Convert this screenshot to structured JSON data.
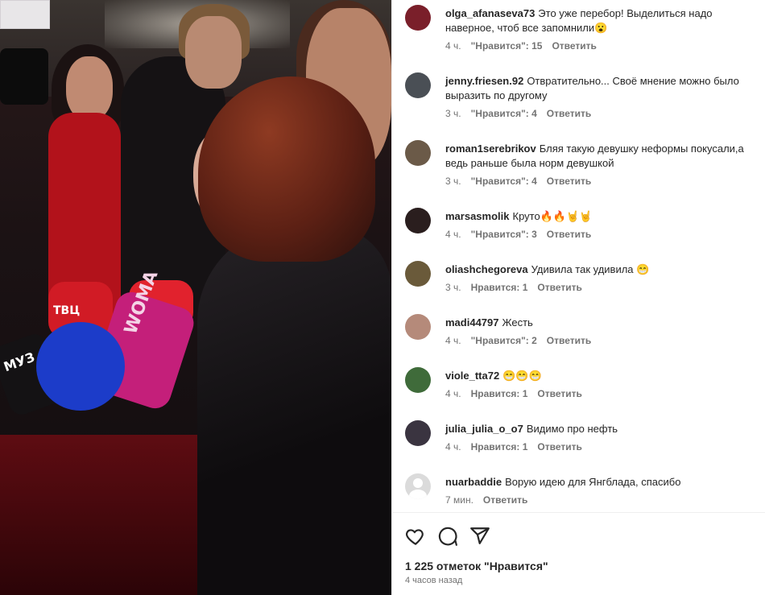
{
  "photo": {
    "mic_labels": {
      "tvc": "ТВЦ",
      "woman": "WOMA",
      "muz": "МУЗ"
    }
  },
  "comments": [
    {
      "username": "olga_afanaseva73",
      "text": "Это уже перебор! Выделиться надо наверное, чтоб все запомнили😮",
      "time": "4 ч.",
      "likes": "\"Нравится\": 15",
      "reply": "Ответить",
      "avatar_color": "#7a1f2a"
    },
    {
      "username": "jenny.friesen.92",
      "text": "Отвратительно... Своё мнение можно было выразить по другому",
      "time": "3 ч.",
      "likes": "\"Нравится\": 4",
      "reply": "Ответить",
      "avatar_color": "#4a4f55"
    },
    {
      "username": "roman1serebrikov",
      "text": "Бляя такую девушку неформы покусали,а ведь раньше была норм девушкой",
      "time": "3 ч.",
      "likes": "\"Нравится\": 4",
      "reply": "Ответить",
      "avatar_color": "#6b5a48"
    },
    {
      "username": "marsasmolik",
      "text": "Круто🔥🔥🤘🤘",
      "time": "4 ч.",
      "likes": "\"Нравится\": 3",
      "reply": "Ответить",
      "avatar_color": "#2a1e1e"
    },
    {
      "username": "oliashchegoreva",
      "text": "Удивила так удивила 😁",
      "time": "3 ч.",
      "likes": "Нравится: 1",
      "reply": "Ответить",
      "avatar_color": "#6a5a3a"
    },
    {
      "username": "madi44797",
      "text": "Жесть",
      "time": "4 ч.",
      "likes": "\"Нравится\": 2",
      "reply": "Ответить",
      "avatar_color": "#b58a7a"
    },
    {
      "username": "viole_tta72",
      "text": "😁😁😁",
      "time": "4 ч.",
      "likes": "Нравится: 1",
      "reply": "Ответить",
      "avatar_color": "#3f6b3a"
    },
    {
      "username": "julia_julia_o_o7",
      "text": "Видимо про нефть",
      "time": "4 ч.",
      "likes": "Нравится: 1",
      "reply": "Ответить",
      "avatar_color": "#3a3440"
    },
    {
      "username": "nuarbaddie",
      "text": "Ворую идею для Янгблада, спасибо",
      "time": "7 мин.",
      "likes": "",
      "reply": "Ответить",
      "avatar_color": ""
    }
  ],
  "actions": {
    "likes_count": "1 225 отметок \"Нравится\"",
    "post_time": "4 часов назад",
    "icons": [
      "heart-icon",
      "comment-icon",
      "share-icon"
    ]
  }
}
